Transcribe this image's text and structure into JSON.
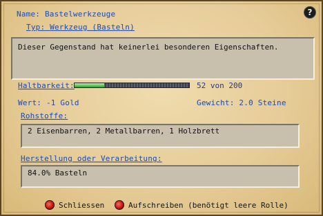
{
  "item": {
    "name_label": "Name:",
    "name_value": "Bastelwerkzeuge",
    "type_label": "Typ:",
    "type_value": "Werkzeug (Basteln)",
    "description": "Dieser Gegenstand hat keinerlei besonderen Eigenschaften."
  },
  "stats": {
    "durability_label": "Haltbarkeit:",
    "durability_current": 52,
    "durability_max": 200,
    "durability_text": "52 von 200",
    "value_label": "Wert:",
    "value_value": "-1 Gold",
    "weight_label": "Gewicht:",
    "weight_value": "2.0 Steine"
  },
  "materials": {
    "label": "Rohstoffe:",
    "text": "2 Eisenbarren, 2 Metallbarren, 1 Holzbrett"
  },
  "crafting": {
    "label": "Herstellung oder Verarbeitung:",
    "text": "84.0% Basteln"
  },
  "buttons": {
    "close": "Schliessen",
    "write": "Aufschreiben (benötigt leere Rolle)",
    "help": "?"
  },
  "colors": {
    "label": "#2a52a8",
    "parchment": "#e6cc98",
    "box": "#c8c0ac",
    "button_gem": "#c21a10"
  }
}
